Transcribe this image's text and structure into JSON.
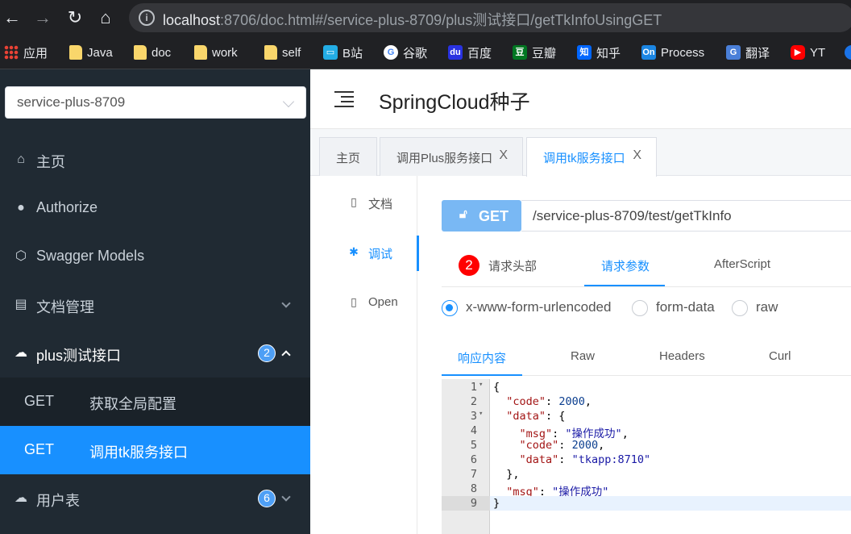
{
  "browser": {
    "url_host": "localhost",
    "url_rest": ":8706/doc.html#/service-plus-8709/plus测试接口/getTkInfoUsingGET",
    "bookmarks": [
      {
        "label": "应用",
        "icon": "apps-grid-icon"
      },
      {
        "label": "Java",
        "icon": "folder-icon"
      },
      {
        "label": "doc",
        "icon": "folder-icon"
      },
      {
        "label": "work",
        "icon": "folder-icon"
      },
      {
        "label": "self",
        "icon": "folder-icon"
      },
      {
        "label": "B站",
        "icon": "bilibili-icon"
      },
      {
        "label": "谷歌",
        "icon": "google-icon"
      },
      {
        "label": "百度",
        "icon": "baidu-icon"
      },
      {
        "label": "豆瓣",
        "icon": "douban-icon"
      },
      {
        "label": "知乎",
        "icon": "zhihu-icon"
      },
      {
        "label": "Process",
        "icon": "processon-icon"
      },
      {
        "label": "翻译",
        "icon": "translate-icon"
      },
      {
        "label": "YT",
        "icon": "youtube-icon"
      }
    ]
  },
  "sidebar": {
    "service_select": "service-plus-8709",
    "menu": [
      {
        "label": "主页",
        "icon": "home-icon"
      },
      {
        "label": "Authorize",
        "icon": "lock-icon"
      },
      {
        "label": "Swagger Models",
        "icon": "cube-icon"
      },
      {
        "label": "文档管理",
        "icon": "doc-manage-icon"
      },
      {
        "label": "plus测试接口",
        "icon": "cloud-icon",
        "badge": "2"
      },
      {
        "label": "用户表",
        "icon": "cloud-icon",
        "badge": "6"
      }
    ],
    "sub_items": [
      {
        "method": "GET",
        "label": "获取全局配置"
      },
      {
        "method": "GET",
        "label": "调用tk服务接口"
      }
    ]
  },
  "header": {
    "title": "SpringCloud种子"
  },
  "tabs": [
    {
      "label": "主页"
    },
    {
      "label": "调用Plus服务接口",
      "close": "X"
    },
    {
      "label": "调用tk服务接口",
      "close": "X"
    }
  ],
  "docnav": [
    {
      "label": "文档",
      "icon": "document-icon"
    },
    {
      "label": "调试",
      "icon": "bug-icon"
    },
    {
      "label": "Open",
      "icon": "file-icon"
    }
  ],
  "request": {
    "method": "GET",
    "url": "/service-plus-8709/test/getTkInfo",
    "tabs": [
      "请求头部",
      "请求参数",
      "AfterScript"
    ],
    "header_count": "2",
    "content_types": [
      "x-www-form-urlencoded",
      "form-data",
      "raw"
    ],
    "selected_content_type": "x-www-form-urlencoded"
  },
  "response": {
    "tabs": [
      "响应内容",
      "Raw",
      "Headers",
      "Curl"
    ],
    "line_numbers": [
      "1",
      "2",
      "3",
      "4",
      "5",
      "6",
      "7",
      "8",
      "9"
    ],
    "json": {
      "code_key": "\"code\"",
      "code_val": "2000",
      "data_key": "\"data\"",
      "msg_key": "\"msg\"",
      "msg_val": "\"操作成功\"",
      "data_code_val": "2000",
      "data_data_val": "\"tkapp:8710\""
    }
  },
  "colors": {
    "accent": "#1890ff",
    "sidebar_bg": "#202a33",
    "get_button": "#79b8f4",
    "badge_red": "#ff0000"
  }
}
